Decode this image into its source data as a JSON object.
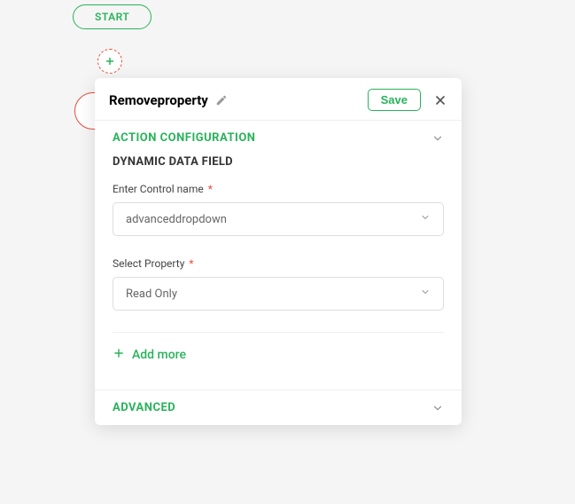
{
  "flow": {
    "start_label": "START"
  },
  "panel": {
    "title": "Removeproperty",
    "save_label": "Save",
    "sections": {
      "action_config_label": "ACTION CONFIGURATION",
      "advanced_label": "ADVANCED"
    },
    "subheading": "DYNAMIC DATA FIELD",
    "fields": {
      "control_name_label": "Enter Control name",
      "control_name_value": "advanceddropdown",
      "select_property_label": "Select Property",
      "select_property_value": "Read Only"
    },
    "add_more_label": "Add more"
  }
}
